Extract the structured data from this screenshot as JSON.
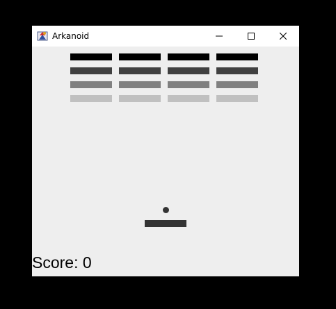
{
  "window": {
    "title": "Arkanoid",
    "icons": {
      "app": "java-app-icon",
      "minimize": "minimize-icon",
      "maximize": "maximize-icon",
      "close": "close-icon"
    }
  },
  "game": {
    "score_label": "Score: 0",
    "score": 0,
    "brick_rows": [
      {
        "color": "#000000",
        "count": 4
      },
      {
        "color": "#404040",
        "count": 4
      },
      {
        "color": "#808080",
        "count": 4
      },
      {
        "color": "#c0c0c0",
        "count": 4
      }
    ],
    "ball_color": "#333333",
    "paddle_color": "#333333"
  }
}
